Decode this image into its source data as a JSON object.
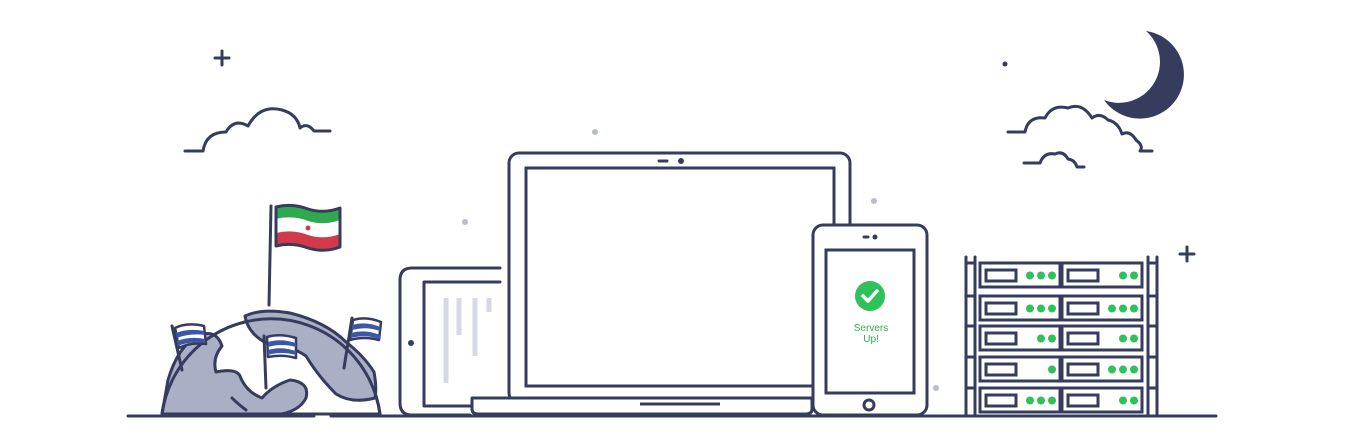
{
  "phone": {
    "status_line1": "Servers",
    "status_line2": "Up!",
    "status_color": "#2fb24f"
  },
  "colors": {
    "line": "#363c5e",
    "globe_fill": "#a9afc4",
    "screen_lines": "#d6d9e3",
    "led_green": "#2fc25a",
    "dot_grey": "#b8bccb",
    "flag_blue": "#3d57a8",
    "flag_green": "#2fa84f",
    "flag_red": "#d23a4c"
  },
  "icons": [
    "globe-icon",
    "flag-icon",
    "laptop-icon",
    "tablet-icon",
    "phone-icon",
    "check-icon",
    "server-rack-icon",
    "cloud-icon",
    "moon-icon",
    "star-icon"
  ]
}
